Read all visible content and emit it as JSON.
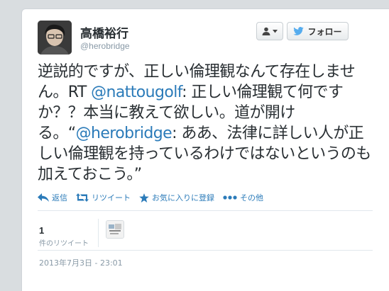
{
  "user": {
    "display_name": "高橋裕行",
    "handle": "@herobridge",
    "avatar_icon": "avatar-photo"
  },
  "header": {
    "user_menu_icon": "person-dropdown-icon",
    "follow_label": "フォロー",
    "follow_icon": "twitter-bird-icon"
  },
  "tweet": {
    "text_part1": "逆説的ですが、正しい倫理観なんて存在しません。RT ",
    "mention1": "@nattougolf",
    "text_part2": ": 正しい倫理観て何ですか？？本当に教えて欲しい。道が開ける。“",
    "mention2": "@herobridge",
    "text_part3": ": ああ、法律に詳しい人が正しい倫理観を持っているわけではないというのも加えておこう。”"
  },
  "actions": {
    "reply": "返信",
    "retweet": "リツイート",
    "favorite": "お気に入りに登録",
    "more": "その他"
  },
  "stats": {
    "retweet_count": "1",
    "retweet_label": "件のリツイート"
  },
  "timestamp": "2013年7月3日 - 23:01",
  "colors": {
    "link": "#2b7bb9",
    "text": "#292f33",
    "muted": "#8899a6"
  }
}
